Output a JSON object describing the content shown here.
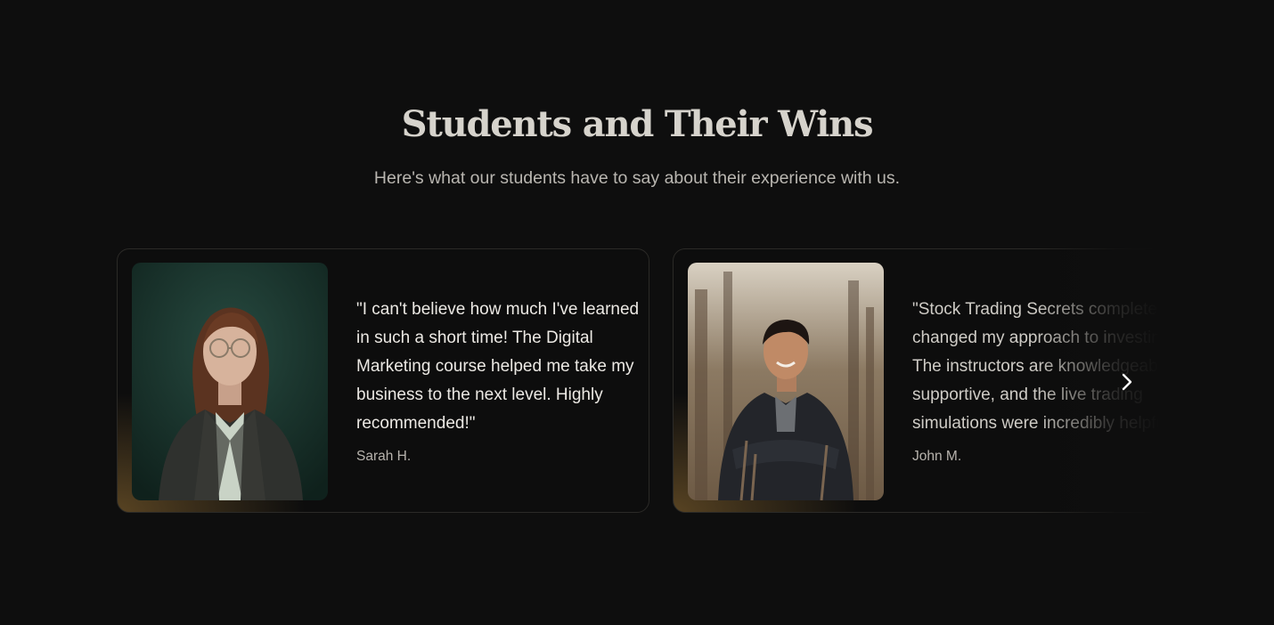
{
  "section": {
    "title": "Students and Their Wins",
    "subtitle": "Here's what our students have to say about their experience with us."
  },
  "testimonials": [
    {
      "quote": "\"I can't believe how much I've learned in such a short time! The Digital Marketing course helped me take my business to the next level. Highly recommended!\"",
      "author": "Sarah H."
    },
    {
      "quote": "\"Stock Trading Secrets completely changed my approach to investing. The instructors are knowledgeable and supportive, and the live trading simulations were incredibly helpful.",
      "author": "John M."
    }
  ],
  "icons": {
    "next": "chevron-right-icon"
  },
  "colors": {
    "background": "#0e0e0e",
    "accent_glow": "#96703a"
  }
}
